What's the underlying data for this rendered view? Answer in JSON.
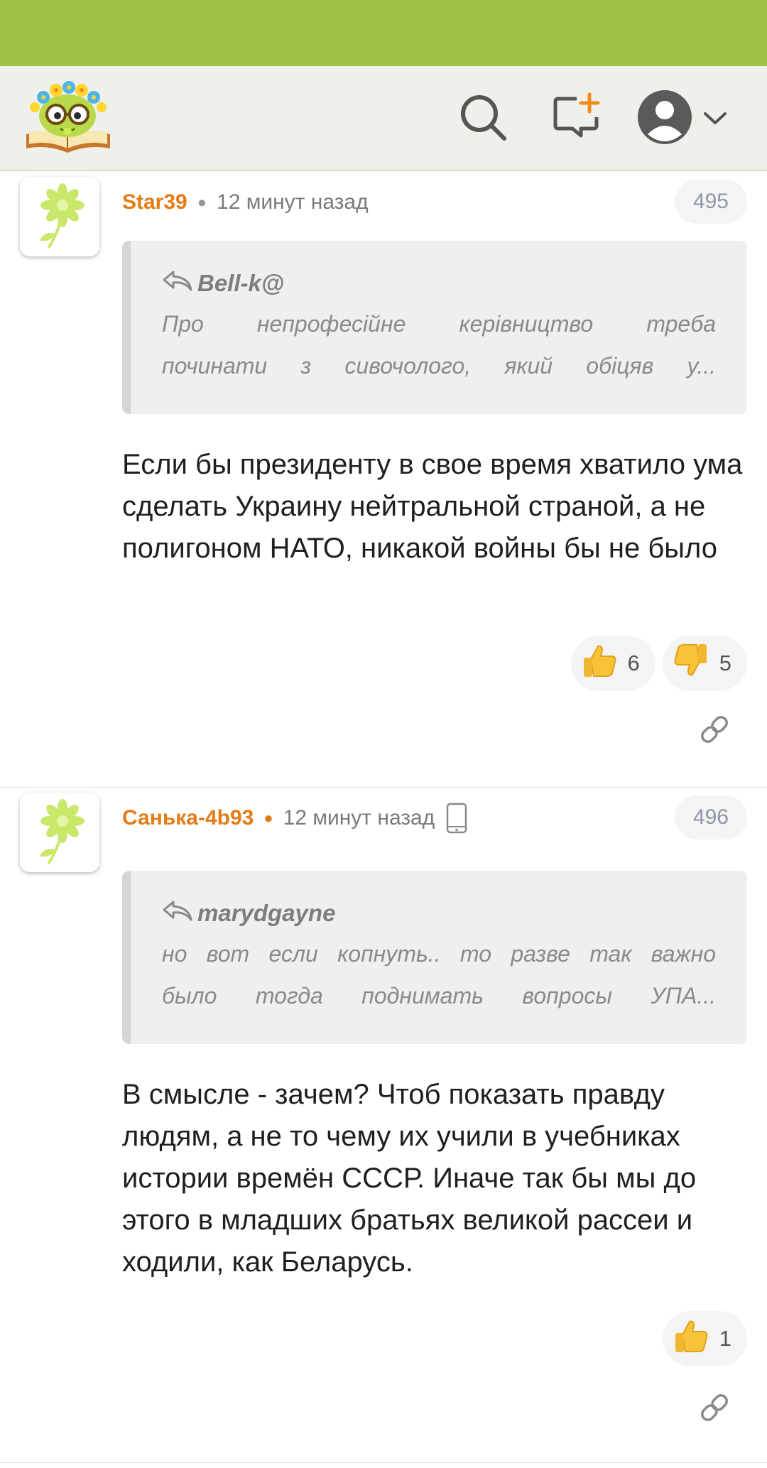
{
  "colors": {
    "status_bar": "#9dc142",
    "header": "#f0f0ea",
    "author": "#e47b14",
    "comment_number": "#8a96a8"
  },
  "header": {
    "logo": "flower-wreath-book-mascot-logo",
    "icons": [
      "search-icon",
      "new-post-icon",
      "user-avatar-icon",
      "chevron-down-icon"
    ]
  },
  "comments": [
    {
      "author": "Star39",
      "time": "12 минут назад",
      "number": "495",
      "avatar": "flower-icon",
      "quote": {
        "author": "Bell-k@",
        "lines": [
          "Про непрофесійне керівництво треба",
          "починати з сивочолого, який обіцяв у..."
        ]
      },
      "body": "Если бы президенту в свое время хватило ума сделать Украину нейтральной страной, а не полигоном НАТО, никакой войны бы не было",
      "likes": "6",
      "dislikes": "5"
    },
    {
      "author": "Санька-4b93",
      "time": "12 минут назад",
      "number": "496",
      "avatar": "flower-icon",
      "device": "mobile-phone-icon",
      "quote": {
        "author": "marydgayne",
        "lines": [
          "но вот если копнуть.. то разве так важно",
          "было тогда поднимать вопросы УПА..."
        ]
      },
      "body": "В смысле - зачем? Чтоб показать правду людям, а не то чему их учили в учебниках истории времён СССР. Иначе так бы мы до этого в младших братьях великой рассеи и ходили, как Беларусь.",
      "likes": "1"
    }
  ]
}
